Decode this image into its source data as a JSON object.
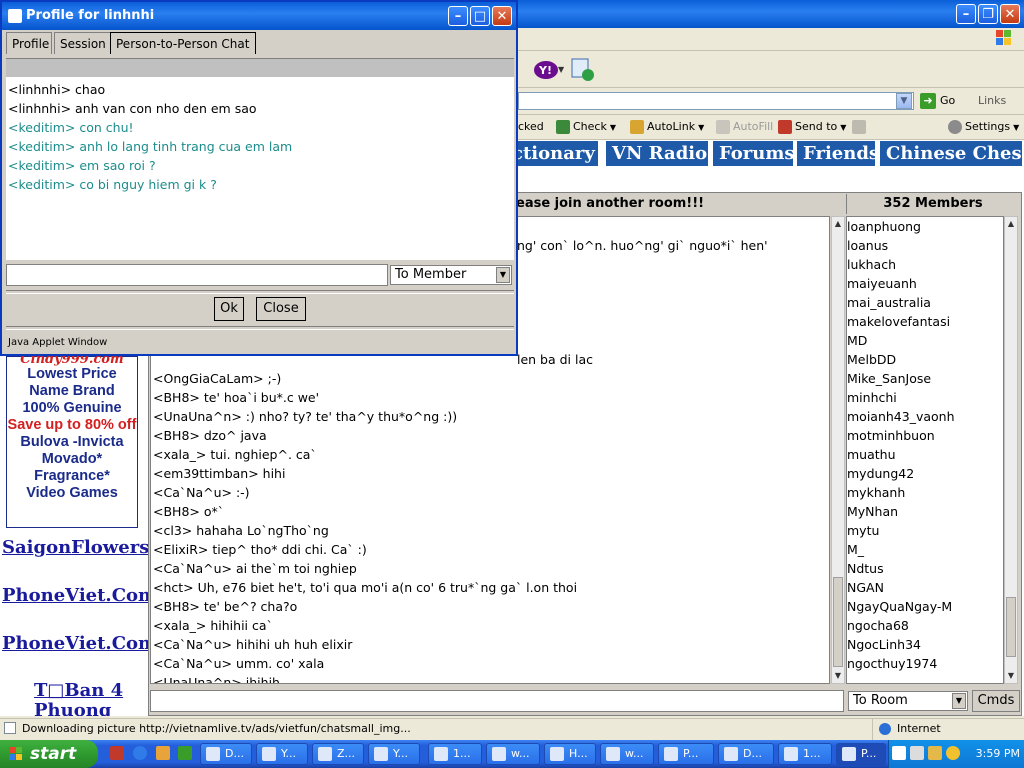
{
  "colors": {
    "title_blue": "#0a5fd8",
    "nav_blue": "#1e5aa8",
    "teal_text": "#1d8c8c",
    "link_blue": "#1a1a9c",
    "ad_red": "#d42020",
    "ad_blue": "#1b2b8a",
    "taskbar_blue": "#245edb",
    "start_green": "#2f9a2f"
  },
  "dialog": {
    "title": "Profile for linhnhi",
    "tabs": [
      "Profile",
      "Session",
      "Person-to-Person Chat"
    ],
    "active_tab": "Person-to-Person Chat",
    "messages": [
      {
        "text": "<linhnhi>  chao",
        "color": "#000000"
      },
      {
        "text": "<linhnhi>  anh van con nho den em sao",
        "color": "#000000"
      },
      {
        "text": "<keditim> con chu!",
        "color": "#1d8c8c"
      },
      {
        "text": "<keditim> anh lo lang tinh trang cua em lam",
        "color": "#1d8c8c"
      },
      {
        "text": "<keditim> em sao roi ?",
        "color": "#1d8c8c"
      },
      {
        "text": "<keditim> co bi nguy hiem gi k ?",
        "color": "#1d8c8c"
      }
    ],
    "input_value": "",
    "send_target": "To Member",
    "ok_label": "Ok",
    "close_label": "Close",
    "footer": "Java Applet Window"
  },
  "browser": {
    "go_label": "Go",
    "links_label": "Links",
    "google_tools": [
      {
        "label": "cked",
        "icon": ""
      },
      {
        "label": "Check",
        "icon": "spellcheck-icon"
      },
      {
        "label": "AutoLink",
        "icon": "autolink-icon"
      },
      {
        "label": "AutoFill",
        "icon": "autofill-icon"
      },
      {
        "label": "Send to",
        "icon": "sendto-icon"
      },
      {
        "label": "Settings",
        "icon": "settings-icon"
      }
    ],
    "status_text": "Downloading picture http://vietnamlive.tv/ads/vietfun/chatsmall_img...",
    "zone": "Internet"
  },
  "site_nav": [
    "ctionary",
    "VN Radio",
    "Forums",
    "Friends",
    "Chinese Chess"
  ],
  "left_ads": {
    "cindy_header": "Cindy999.com",
    "cindy_lines": [
      {
        "text": "Lowest Price",
        "color": "#1b2b8a"
      },
      {
        "text": "Name Brand",
        "color": "#1b2b8a"
      },
      {
        "text": "100% Genuine",
        "color": "#1b2b8a"
      },
      {
        "text": "Save up to 80% off",
        "color": "#d42020"
      },
      {
        "text": "Bulova -Invicta",
        "color": "#1b2b8a"
      },
      {
        "text": "Movado*",
        "color": "#1b2b8a"
      },
      {
        "text": "Fragrance*",
        "color": "#1b2b8a"
      },
      {
        "text": "Video Games",
        "color": "#1b2b8a"
      }
    ],
    "links": [
      "SaigonFlowers.c",
      "PhoneViet.Com",
      "PhoneViet.Com",
      "T□Ban 4",
      "Phuong"
    ]
  },
  "chatroom": {
    "room_header": "ease join another room!!!",
    "members_header": "352 Members",
    "messages": [
      "ng' con` lo^n. huo^ng' gi` nguo*i` hen'",
      "",
      "",
      "",
      "",
      "",
      "len ba di lac",
      "<OngGiaCaLam> ;-)",
      "<BH8> te' hoa`i bu*.c we'",
      "<UnaUna^n> :) nho? ty? te' tha^y thu*o^ng :))",
      "<BH8> dzo^ java",
      "<xala_> tui. nghiep^. ca`",
      "<em39ttimban> hihi",
      "<Ca`Na^u> :-)",
      "<BH8> o*`",
      "<cl3> hahaha Lo`ngTho`ng",
      "<ElixiR> tiep^ tho* ddi chi. Ca` :)",
      "<Ca`Na^u> ai the`m toi nghiep",
      "<hct> Uh, e76 biet he't, to'i qua mo'i a(n co' 6 tru*`ng ga` l.on thoi",
      "<BH8> te' be^? cha?o",
      "<xala_> hihihii ca`",
      "<Ca`Na^u> hihihi uh huh elixir",
      "<Ca`Na^u> umm. co' xala",
      "<UnaUna^n> ihihih"
    ],
    "members": [
      "loanphuong",
      "loanus",
      "lukhach",
      "maiyeuanh",
      "mai_australia",
      "makelovefantasi",
      "MD",
      "MelbDD",
      "Mike_SanJose",
      "minhchi",
      "moianh43_vaonh",
      "motminhbuon",
      "muathu",
      "mydung42",
      "mykhanh",
      "MyNhan",
      "mytu",
      "M_",
      "Ndtus",
      "NGAN",
      "NgayQuaNgay-M",
      "ngocha68",
      "NgocLinh34",
      "ngocthuy1974"
    ],
    "input_value": "",
    "send_target": "To Room",
    "cmds_label": "Cmds"
  },
  "taskbar": {
    "start_label": "start",
    "items": [
      "D...",
      "Y...",
      "Z...",
      "Y...",
      "1...",
      "w...",
      "H...",
      "w...",
      "P...",
      "D...",
      "1...",
      "P..."
    ],
    "clock": "3:59 PM"
  }
}
